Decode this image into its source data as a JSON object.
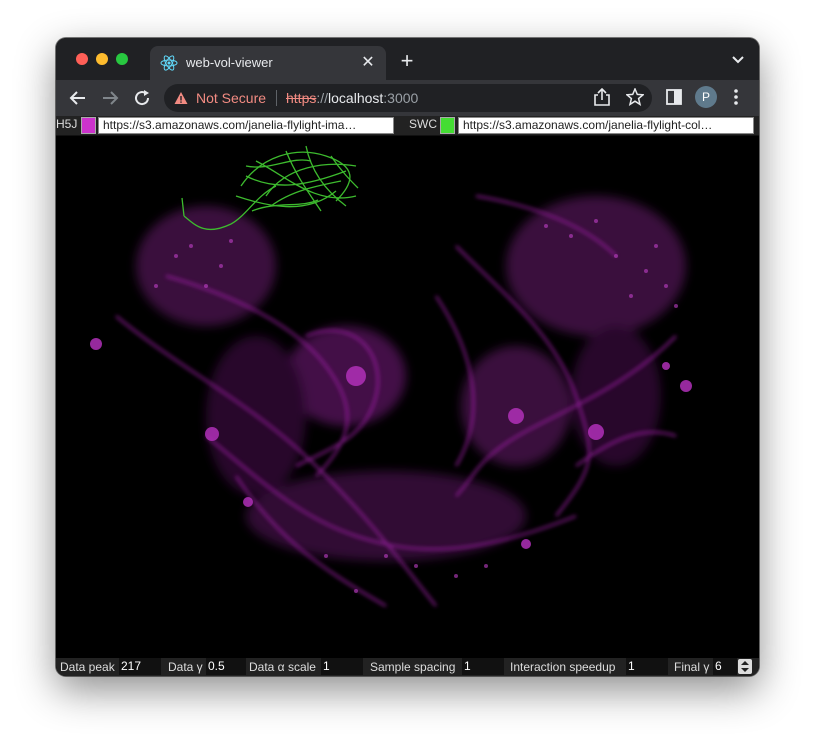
{
  "browser": {
    "tab_title": "web-vol-viewer",
    "security_label": "Not Secure",
    "url_scheme": "https",
    "url_sep": "://",
    "url_host": "localhost",
    "url_port": ":3000",
    "avatar_initial": "P"
  },
  "inputs": {
    "h5j_label": "H5J",
    "h5j_color": "#cc33cc",
    "h5j_url": "https://s3.amazonaws.com/janelia-flylight-ima…",
    "swc_label": "SWC",
    "swc_color": "#44dd33",
    "swc_url": "https://s3.amazonaws.com/janelia-flylight-col…"
  },
  "controls": [
    {
      "label": "Data peak",
      "value": "217"
    },
    {
      "label": "Data γ",
      "value": "0.5"
    },
    {
      "label": "Data α scale",
      "value": "1"
    },
    {
      "label": "Sample spacing",
      "value": "1"
    },
    {
      "label": "Interaction speedup",
      "value": "1"
    },
    {
      "label": "Final γ",
      "value": "6"
    }
  ],
  "colors": {
    "volume": "#a020a8",
    "neuron": "#3dbb2e"
  }
}
